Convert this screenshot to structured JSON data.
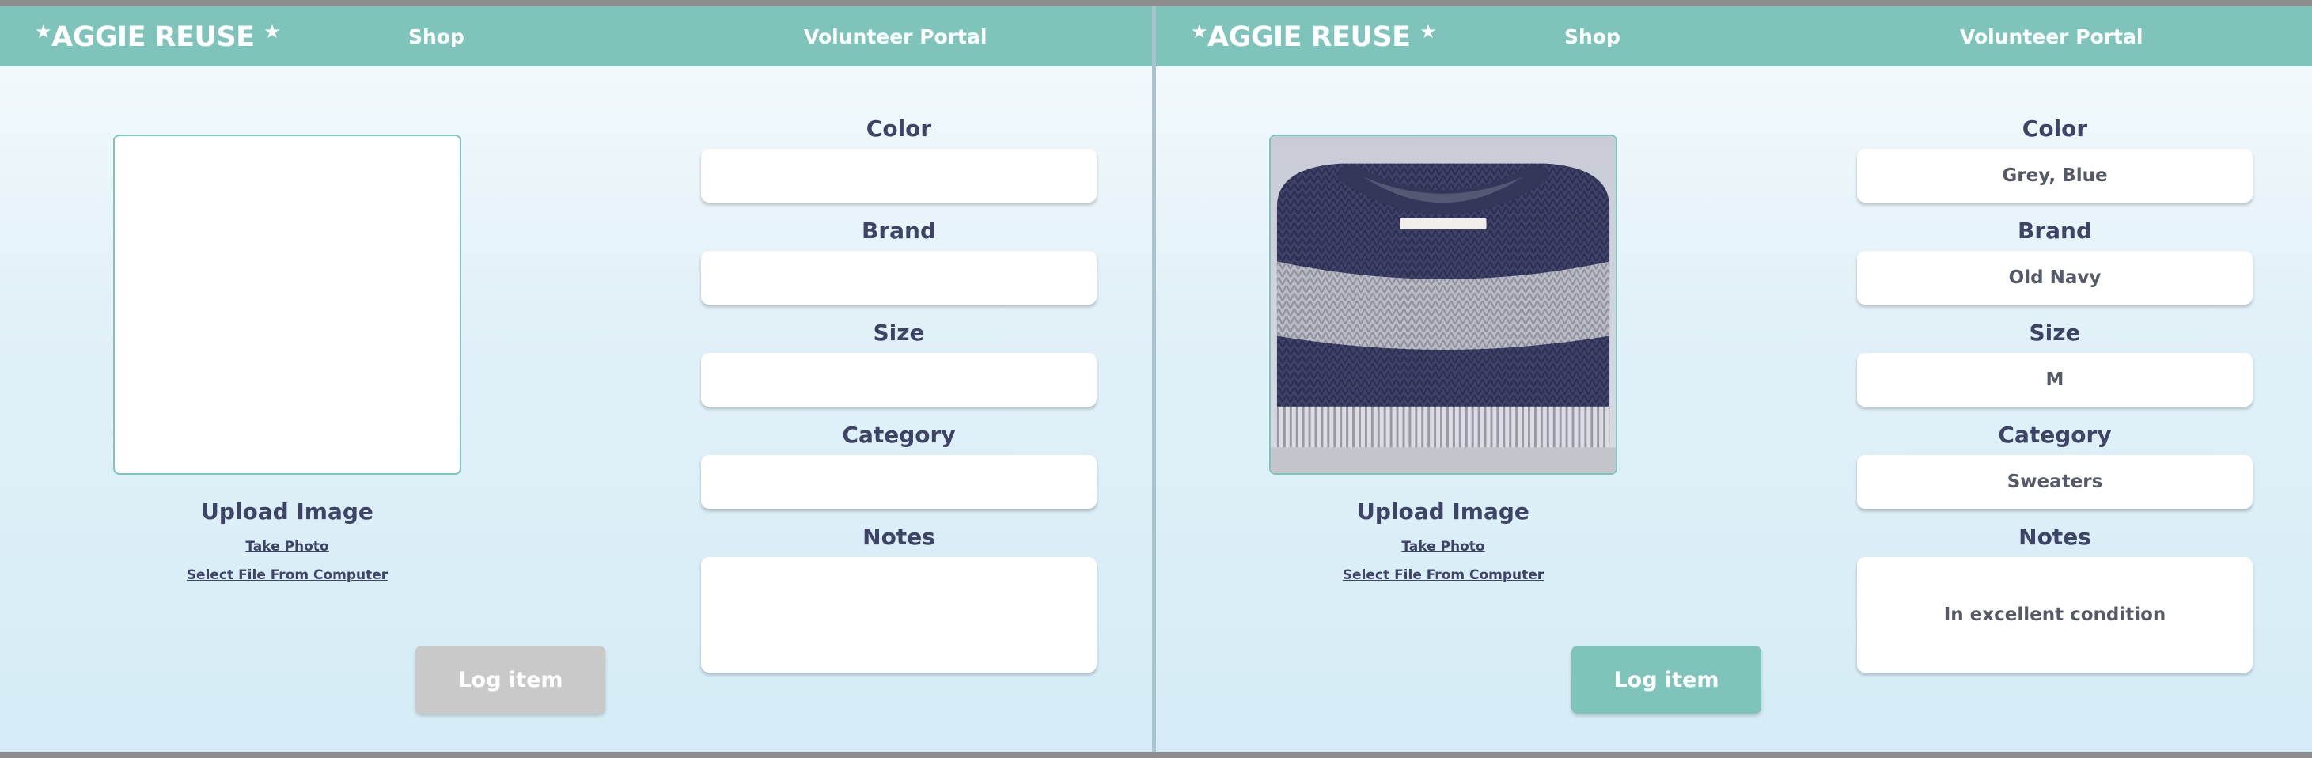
{
  "colors": {
    "nav": "#7ec4ba",
    "text": "#3e4466",
    "button_disabled": "#c9c9c9",
    "button_enabled": "#7ec4ba"
  },
  "screens": [
    {
      "nav": {
        "logo": "AGGIE REUSE",
        "shop": "Shop",
        "volunteer": "Volunteer Portal"
      },
      "upload": {
        "title": "Upload Image",
        "take_photo": "Take Photo",
        "select_file": "Select File From Computer"
      },
      "fields": {
        "color_label": "Color",
        "color_value": "",
        "brand_label": "Brand",
        "brand_value": "",
        "size_label": "Size",
        "size_value": "",
        "category_label": "Category",
        "category_value": "",
        "notes_label": "Notes",
        "notes_value": ""
      },
      "log_button": "Log item",
      "log_button_state": "disabled",
      "has_image": false
    },
    {
      "nav": {
        "logo": "AGGIE REUSE",
        "shop": "Shop",
        "volunteer": "Volunteer Portal"
      },
      "upload": {
        "title": "Upload Image",
        "take_photo": "Take Photo",
        "select_file": "Select File From Computer"
      },
      "fields": {
        "color_label": "Color",
        "color_value": "Grey, Blue",
        "brand_label": "Brand",
        "brand_value": "Old Navy",
        "size_label": "Size",
        "size_value": "M",
        "category_label": "Category",
        "category_value": "Sweaters",
        "notes_label": "Notes",
        "notes_value": "In excellent condition"
      },
      "log_button": "Log item",
      "log_button_state": "enabled",
      "has_image": true
    }
  ]
}
